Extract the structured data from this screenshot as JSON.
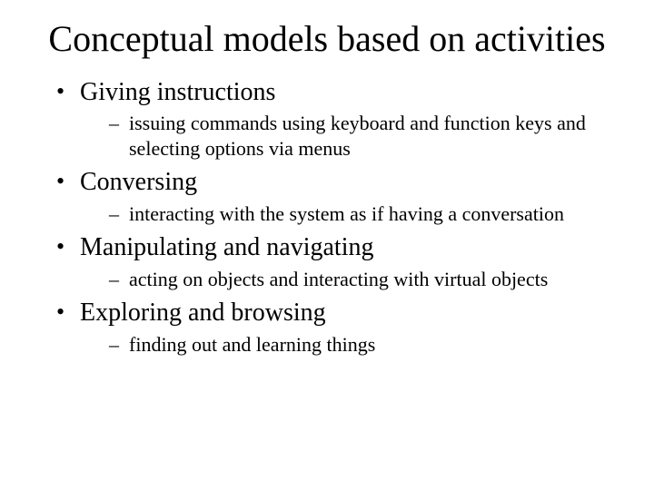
{
  "title": "Conceptual models based on activities",
  "bullets": [
    {
      "label": "Giving instructions",
      "sub": [
        "issuing commands using keyboard and function keys and selecting options via menus"
      ]
    },
    {
      "label": "Conversing",
      "sub": [
        "interacting with the system as if having a conversation"
      ]
    },
    {
      "label": "Manipulating and navigating",
      "sub": [
        "acting on objects and interacting with virtual objects"
      ]
    },
    {
      "label": "Exploring and browsing",
      "sub": [
        "finding out and learning things"
      ]
    }
  ]
}
